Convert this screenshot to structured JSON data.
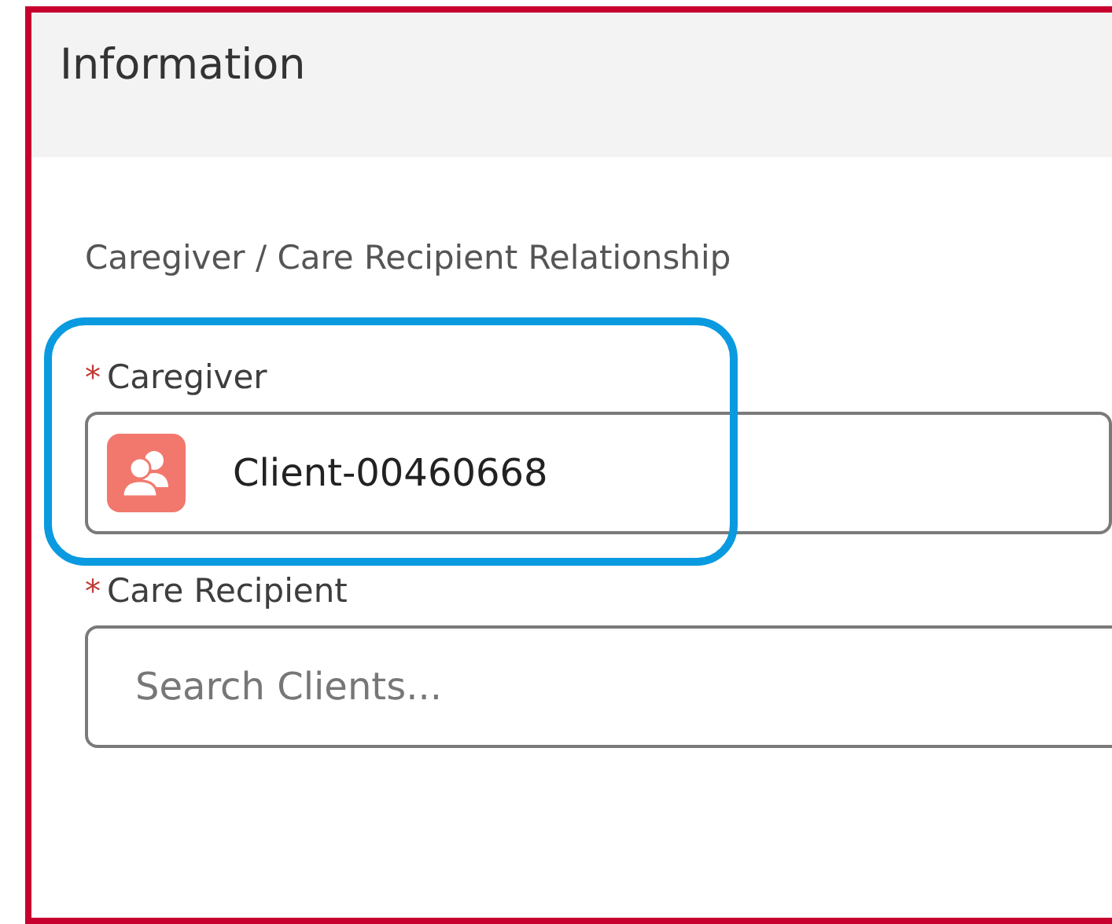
{
  "header": {
    "title": "Information"
  },
  "section": {
    "title": "Caregiver / Care Recipient Relationship"
  },
  "fields": [
    {
      "label": "Caregiver",
      "required_mark": "*",
      "kind": "lookup",
      "value": "Client-00460668",
      "highlighted": true
    },
    {
      "label": "Care Recipient",
      "required_mark": "*",
      "kind": "search",
      "placeholder": "Search Clients...",
      "highlighted": false
    }
  ]
}
